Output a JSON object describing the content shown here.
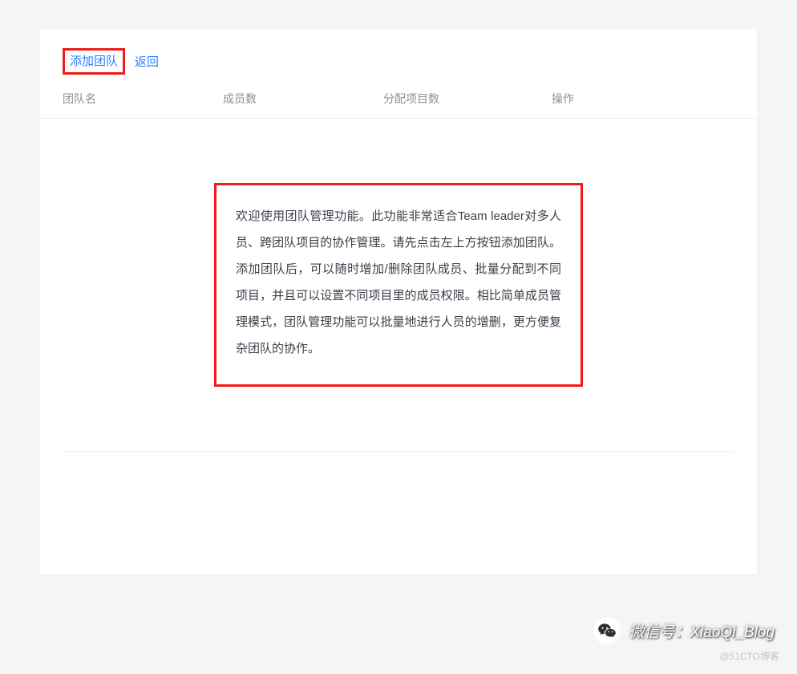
{
  "toolbar": {
    "add_team_label": "添加团队",
    "back_label": "返回"
  },
  "table": {
    "headers": {
      "name": "团队名",
      "members": "成员数",
      "projects": "分配项目数",
      "actions": "操作"
    }
  },
  "info": {
    "message": "欢迎使用团队管理功能。此功能非常适合Team leader对多人员、跨团队项目的协作管理。请先点击左上方按钮添加团队。添加团队后，可以随时增加/删除团队成员、批量分配到不同项目，并且可以设置不同项目里的成员权限。相比简单成员管理模式，团队管理功能可以批量地进行人员的增删，更方便复杂团队的协作。"
  },
  "footer": {
    "wechat_label": "微信号：XiaoQi_Blog",
    "copyright": "@51CTO博客"
  }
}
